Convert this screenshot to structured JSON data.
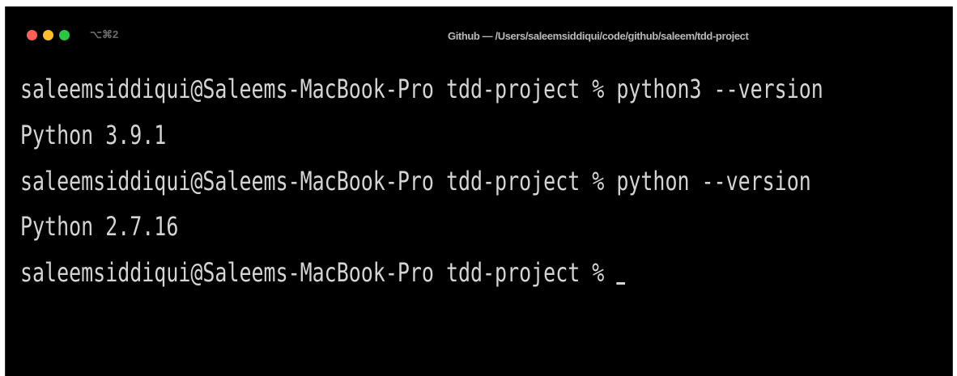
{
  "window": {
    "shortcut": "⌥⌘2",
    "title": "Github — /Users/saleemsiddiqui/code/github/saleem/tdd-project"
  },
  "colors": {
    "close": "#ff5f57",
    "minimize": "#febc2e",
    "zoom": "#28c840",
    "background": "#000000",
    "text": "#d4d4d4"
  },
  "terminal": {
    "lines": [
      {
        "prompt": "saleemsiddiqui@Saleems-MacBook-Pro tdd-project % ",
        "command": "python3 --version"
      },
      {
        "output": "Python 3.9.1"
      },
      {
        "prompt": "saleemsiddiqui@Saleems-MacBook-Pro tdd-project % ",
        "command": "python --version"
      },
      {
        "output": "Python 2.7.16"
      },
      {
        "prompt": "saleemsiddiqui@Saleems-MacBook-Pro tdd-project % ",
        "command": ""
      }
    ]
  }
}
